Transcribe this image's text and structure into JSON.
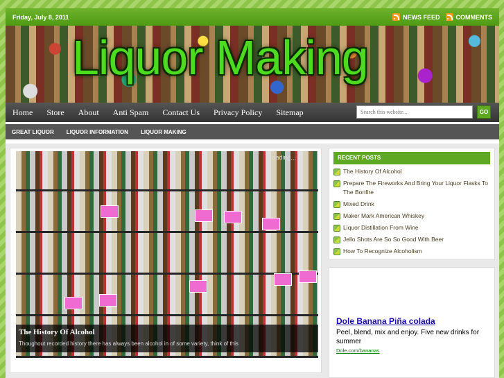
{
  "topbar": {
    "date": "Friday, July 8, 2011",
    "news_feed": "NEWS FEED",
    "comments": "COMMENTS"
  },
  "header": {
    "site_title": "Liquor Making"
  },
  "nav": {
    "items": [
      "Home",
      "Store",
      "About",
      "Anti Spam",
      "Contact Us",
      "Privacy Policy",
      "Sitemap"
    ],
    "search_placeholder": "Search this website...",
    "go_label": "GO"
  },
  "subnav": {
    "items": [
      "GREAT LIQUOR",
      "LIQUOR INFORMATION",
      "LIQUOR MAKING"
    ]
  },
  "slider": {
    "loading": "Loading...",
    "title": "The History Of Alcohol",
    "excerpt": "Thoughout recorded history there has always been alcohol in of some variety, think of this"
  },
  "sidebar": {
    "recent_title": "RECENT POSTS",
    "posts": [
      "The History Of Alcohol",
      "Prepare The Fireworks And Bring Your Liquor Flasks To The Bonfire",
      "Mixed Drink",
      "Maker Mark American Whiskey",
      "Liquor Distillation From Wine",
      "Jello Shots Are So So Good With Beer",
      "How To Recognize Alcoholism"
    ]
  },
  "ad": {
    "title": "Dole Banana Piña colada",
    "text": "Peel, blend, mix and enjoy. Five new drinks for summer",
    "url": "Dole.com/bananas"
  }
}
